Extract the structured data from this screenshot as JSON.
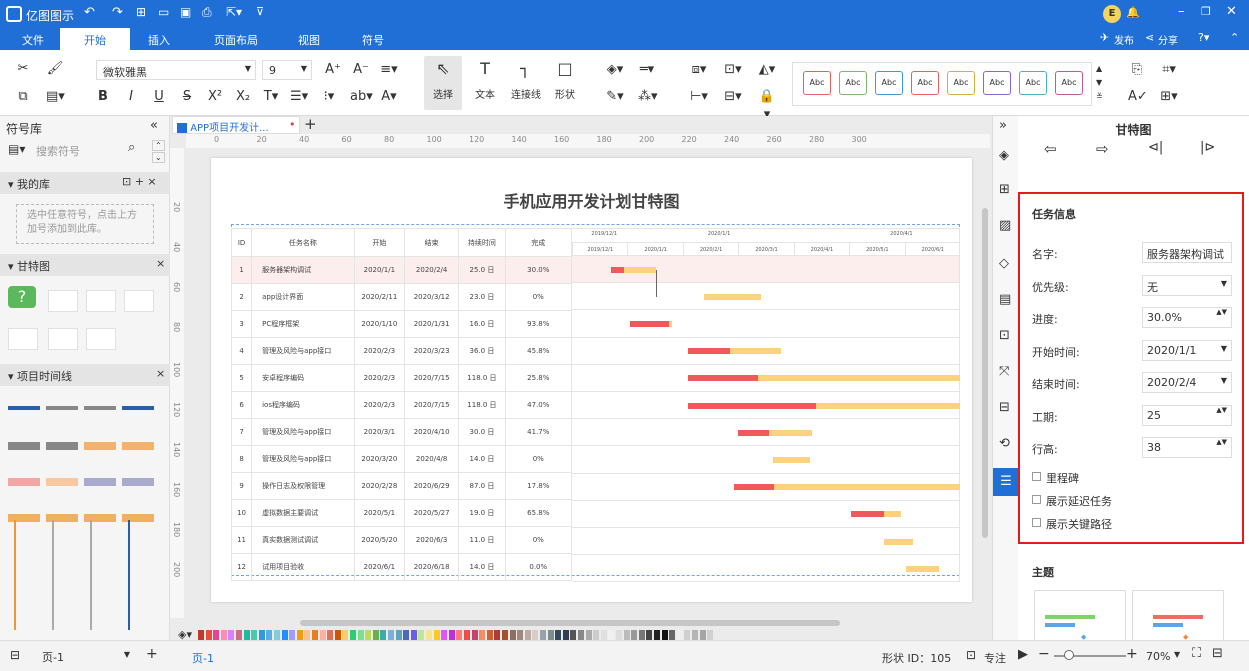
{
  "app": {
    "logo_text": "亿图图示",
    "bell_letter": "E"
  },
  "menu": {
    "tabs": [
      "文件",
      "开始",
      "插入",
      "页面布局",
      "视图",
      "符号"
    ],
    "active": "开始",
    "publish": "发布",
    "share": "分享"
  },
  "toolbar": {
    "font_name": "微软雅黑",
    "font_size": "9",
    "select_label": "选择",
    "text_label": "文本",
    "connector_label": "连接线",
    "shape_label": "形状",
    "style_sample": "Abc",
    "style_colors": [
      "#e5625c",
      "#7fb56f",
      "#3c9ad6",
      "#e5625c",
      "#d9b03b",
      "#8a64d6",
      "#4ab0c8",
      "#c25a9a"
    ]
  },
  "left_panel": {
    "title": "符号库",
    "search_placeholder": "搜索符号",
    "my_library": "我的库",
    "my_library_hint": "选中任意符号，点击上方加号添加到此库。",
    "gantt_section": "甘特图",
    "timeline_section": "项目时间线"
  },
  "doc_tab": {
    "name": "APP项目开发计..."
  },
  "ruler": {
    "top": [
      "0",
      "20",
      "40",
      "60",
      "80",
      "100",
      "120",
      "140",
      "160",
      "180",
      "200",
      "220",
      "240",
      "260",
      "280",
      "300"
    ],
    "left": [
      "20",
      "40",
      "60",
      "80",
      "100",
      "120",
      "140",
      "160",
      "180",
      "200"
    ]
  },
  "chart_data": {
    "type": "table",
    "title": "手机应用开发计划甘特图",
    "columns": [
      "ID",
      "任务名称",
      "开始",
      "结束",
      "持续时间",
      "完成"
    ],
    "timeline_top": [
      "2019/12/1",
      "2020/1/1",
      "2020/4/1"
    ],
    "timeline_bottom": [
      "2019/12/1",
      "2020/1/1",
      "2020/2/1",
      "2020/3/1",
      "2020/4/1",
      "2020/5/1",
      "2020/6/1"
    ],
    "rows": [
      {
        "id": "1",
        "name": "服务器架构调试",
        "start": "2020/1/1",
        "end": "2020/2/4",
        "duration": "25.0 日",
        "complete": "30.0%",
        "s": 0.1,
        "l": 0.117,
        "p": 0.3
      },
      {
        "id": "2",
        "name": "app设计界面",
        "start": "2020/2/11",
        "end": "2020/3/12",
        "duration": "23.0 日",
        "complete": "0%",
        "s": 0.339,
        "l": 0.147,
        "p": 0
      },
      {
        "id": "3",
        "name": "PC程序框架",
        "start": "2020/1/10",
        "end": "2020/1/31",
        "duration": "16.0 日",
        "complete": "93.8%",
        "s": 0.15,
        "l": 0.107,
        "p": 0.938
      },
      {
        "id": "4",
        "name": "管理及风险与app接口",
        "start": "2020/2/3",
        "end": "2020/3/23",
        "duration": "36.0 日",
        "complete": "45.8%",
        "s": 0.298,
        "l": 0.24,
        "p": 0.458
      },
      {
        "id": "5",
        "name": "安卓程序编码",
        "start": "2020/2/3",
        "end": "2020/7/15",
        "duration": "118.0 日",
        "complete": "25.8%",
        "s": 0.298,
        "l": 0.71,
        "p": 0.258
      },
      {
        "id": "6",
        "name": "ios程序编码",
        "start": "2020/2/3",
        "end": "2020/7/15",
        "duration": "118.0 日",
        "complete": "47.0%",
        "s": 0.298,
        "l": 0.71,
        "p": 0.47
      },
      {
        "id": "7",
        "name": "管理及风险与app接口",
        "start": "2020/3/1",
        "end": "2020/4/10",
        "duration": "30.0 日",
        "complete": "41.7%",
        "s": 0.428,
        "l": 0.19,
        "p": 0.417
      },
      {
        "id": "8",
        "name": "管理及风险与app接口",
        "start": "2020/3/20",
        "end": "2020/4/8",
        "duration": "14.0 日",
        "complete": "0%",
        "s": 0.518,
        "l": 0.095,
        "p": 0
      },
      {
        "id": "9",
        "name": "操作日志及权限管理",
        "start": "2020/2/28",
        "end": "2020/6/29",
        "duration": "87.0 日",
        "complete": "17.8%",
        "s": 0.418,
        "l": 0.6,
        "p": 0.178
      },
      {
        "id": "10",
        "name": "虚拟数据主要调试",
        "start": "2020/5/1",
        "end": "2020/5/27",
        "duration": "19.0 日",
        "complete": "65.8%",
        "s": 0.72,
        "l": 0.127,
        "p": 0.658
      },
      {
        "id": "11",
        "name": "真实数据测试调试",
        "start": "2020/5/20",
        "end": "2020/6/3",
        "duration": "11.0 日",
        "complete": "0%",
        "s": 0.803,
        "l": 0.075,
        "p": 0
      },
      {
        "id": "12",
        "name": "试用项目验收",
        "start": "2020/6/1",
        "end": "2020/6/18",
        "duration": "14.0 日",
        "complete": "0.0%",
        "s": 0.86,
        "l": 0.085,
        "p": 0
      }
    ]
  },
  "right_panel": {
    "title": "甘特图",
    "section_title": "任务信息",
    "fields": [
      {
        "label": "名字:",
        "value": "服务器架构调试"
      },
      {
        "label": "优先级:",
        "value": "无"
      },
      {
        "label": "进度:",
        "value": "30.0%"
      },
      {
        "label": "开始时间:",
        "value": "2020/1/1"
      },
      {
        "label": "结束时间:",
        "value": "2020/2/4"
      },
      {
        "label": "工期:",
        "value": "25"
      },
      {
        "label": "行高:",
        "value": "38"
      }
    ],
    "checkboxes": [
      "里程碑",
      "展示延迟任务",
      "展示关键路径"
    ],
    "theme_title": "主题"
  },
  "status": {
    "page_select": "页-1",
    "page_tab": "页-1",
    "shape_id": "形状 ID：105",
    "focus": "专注",
    "zoom": "70%"
  }
}
